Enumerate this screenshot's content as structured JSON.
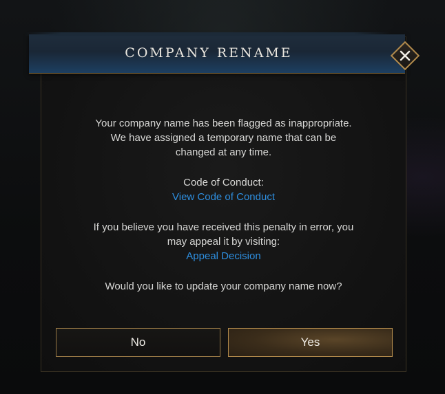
{
  "dialog": {
    "title": "COMPANY RENAME",
    "message_line1": "Your company name has been flagged as inappropriate.",
    "message_line2": "We have assigned a temporary name that can be",
    "message_line3": "changed at any time.",
    "coc_label": "Code of Conduct:",
    "coc_link": "View Code of Conduct",
    "appeal_line1": "If you believe you have received this penalty in error, you",
    "appeal_line2": "may appeal it by visiting:",
    "appeal_link": "Appeal Decision",
    "question": "Would you like to update your company name now?",
    "no_label": "No",
    "yes_label": "Yes",
    "close_icon": "close-icon"
  },
  "colors": {
    "link": "#2e8fe0",
    "gold_border": "#b38b4c",
    "header_blue": "#1d3f61"
  }
}
